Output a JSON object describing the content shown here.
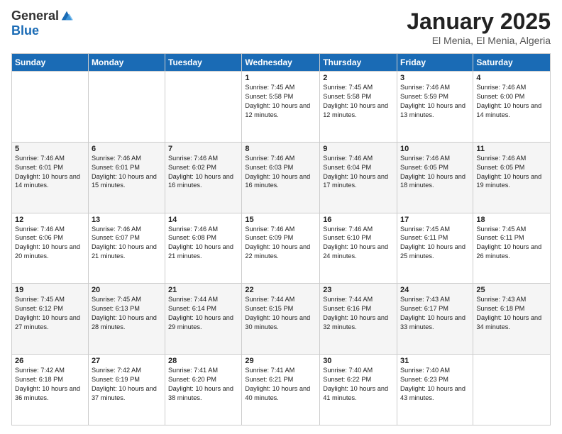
{
  "logo": {
    "general": "General",
    "blue": "Blue"
  },
  "title": "January 2025",
  "subtitle": "El Menia, El Menia, Algeria",
  "days_of_week": [
    "Sunday",
    "Monday",
    "Tuesday",
    "Wednesday",
    "Thursday",
    "Friday",
    "Saturday"
  ],
  "weeks": [
    [
      {
        "day": "",
        "info": ""
      },
      {
        "day": "",
        "info": ""
      },
      {
        "day": "",
        "info": ""
      },
      {
        "day": "1",
        "info": "Sunrise: 7:45 AM\nSunset: 5:58 PM\nDaylight: 10 hours and 12 minutes."
      },
      {
        "day": "2",
        "info": "Sunrise: 7:45 AM\nSunset: 5:58 PM\nDaylight: 10 hours and 12 minutes."
      },
      {
        "day": "3",
        "info": "Sunrise: 7:46 AM\nSunset: 5:59 PM\nDaylight: 10 hours and 13 minutes."
      },
      {
        "day": "4",
        "info": "Sunrise: 7:46 AM\nSunset: 6:00 PM\nDaylight: 10 hours and 14 minutes."
      }
    ],
    [
      {
        "day": "5",
        "info": "Sunrise: 7:46 AM\nSunset: 6:01 PM\nDaylight: 10 hours and 14 minutes."
      },
      {
        "day": "6",
        "info": "Sunrise: 7:46 AM\nSunset: 6:01 PM\nDaylight: 10 hours and 15 minutes."
      },
      {
        "day": "7",
        "info": "Sunrise: 7:46 AM\nSunset: 6:02 PM\nDaylight: 10 hours and 16 minutes."
      },
      {
        "day": "8",
        "info": "Sunrise: 7:46 AM\nSunset: 6:03 PM\nDaylight: 10 hours and 16 minutes."
      },
      {
        "day": "9",
        "info": "Sunrise: 7:46 AM\nSunset: 6:04 PM\nDaylight: 10 hours and 17 minutes."
      },
      {
        "day": "10",
        "info": "Sunrise: 7:46 AM\nSunset: 6:05 PM\nDaylight: 10 hours and 18 minutes."
      },
      {
        "day": "11",
        "info": "Sunrise: 7:46 AM\nSunset: 6:05 PM\nDaylight: 10 hours and 19 minutes."
      }
    ],
    [
      {
        "day": "12",
        "info": "Sunrise: 7:46 AM\nSunset: 6:06 PM\nDaylight: 10 hours and 20 minutes."
      },
      {
        "day": "13",
        "info": "Sunrise: 7:46 AM\nSunset: 6:07 PM\nDaylight: 10 hours and 21 minutes."
      },
      {
        "day": "14",
        "info": "Sunrise: 7:46 AM\nSunset: 6:08 PM\nDaylight: 10 hours and 21 minutes."
      },
      {
        "day": "15",
        "info": "Sunrise: 7:46 AM\nSunset: 6:09 PM\nDaylight: 10 hours and 22 minutes."
      },
      {
        "day": "16",
        "info": "Sunrise: 7:46 AM\nSunset: 6:10 PM\nDaylight: 10 hours and 24 minutes."
      },
      {
        "day": "17",
        "info": "Sunrise: 7:45 AM\nSunset: 6:11 PM\nDaylight: 10 hours and 25 minutes."
      },
      {
        "day": "18",
        "info": "Sunrise: 7:45 AM\nSunset: 6:11 PM\nDaylight: 10 hours and 26 minutes."
      }
    ],
    [
      {
        "day": "19",
        "info": "Sunrise: 7:45 AM\nSunset: 6:12 PM\nDaylight: 10 hours and 27 minutes."
      },
      {
        "day": "20",
        "info": "Sunrise: 7:45 AM\nSunset: 6:13 PM\nDaylight: 10 hours and 28 minutes."
      },
      {
        "day": "21",
        "info": "Sunrise: 7:44 AM\nSunset: 6:14 PM\nDaylight: 10 hours and 29 minutes."
      },
      {
        "day": "22",
        "info": "Sunrise: 7:44 AM\nSunset: 6:15 PM\nDaylight: 10 hours and 30 minutes."
      },
      {
        "day": "23",
        "info": "Sunrise: 7:44 AM\nSunset: 6:16 PM\nDaylight: 10 hours and 32 minutes."
      },
      {
        "day": "24",
        "info": "Sunrise: 7:43 AM\nSunset: 6:17 PM\nDaylight: 10 hours and 33 minutes."
      },
      {
        "day": "25",
        "info": "Sunrise: 7:43 AM\nSunset: 6:18 PM\nDaylight: 10 hours and 34 minutes."
      }
    ],
    [
      {
        "day": "26",
        "info": "Sunrise: 7:42 AM\nSunset: 6:18 PM\nDaylight: 10 hours and 36 minutes."
      },
      {
        "day": "27",
        "info": "Sunrise: 7:42 AM\nSunset: 6:19 PM\nDaylight: 10 hours and 37 minutes."
      },
      {
        "day": "28",
        "info": "Sunrise: 7:41 AM\nSunset: 6:20 PM\nDaylight: 10 hours and 38 minutes."
      },
      {
        "day": "29",
        "info": "Sunrise: 7:41 AM\nSunset: 6:21 PM\nDaylight: 10 hours and 40 minutes."
      },
      {
        "day": "30",
        "info": "Sunrise: 7:40 AM\nSunset: 6:22 PM\nDaylight: 10 hours and 41 minutes."
      },
      {
        "day": "31",
        "info": "Sunrise: 7:40 AM\nSunset: 6:23 PM\nDaylight: 10 hours and 43 minutes."
      },
      {
        "day": "",
        "info": ""
      }
    ]
  ]
}
